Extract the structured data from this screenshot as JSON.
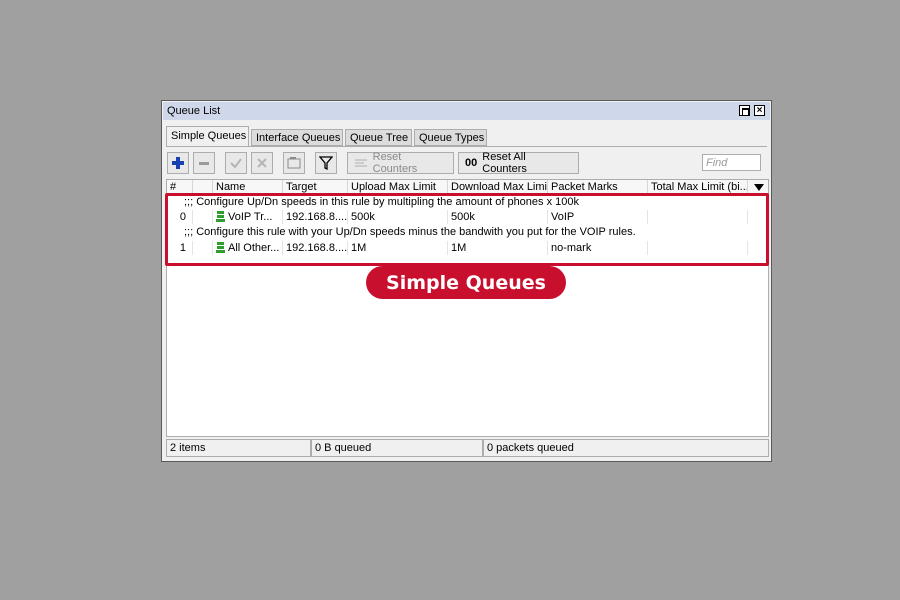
{
  "window": {
    "title": "Queue List"
  },
  "tabs": [
    {
      "label": "Simple Queues"
    },
    {
      "label": "Interface Queues"
    },
    {
      "label": "Queue Tree"
    },
    {
      "label": "Queue Types"
    }
  ],
  "toolbar": {
    "reset_counters": "Reset Counters",
    "reset_all_prefix": "00",
    "reset_all_counters": "Reset All Counters",
    "find_placeholder": "Find"
  },
  "columns": [
    "#",
    "",
    "Name",
    "Target",
    "Upload Max Limit",
    "Download Max Limit",
    "Packet Marks",
    "Total Max Limit (bi..."
  ],
  "rows": [
    {
      "comment": ";;; Configure Up/Dn speeds in this rule by multipling the amount of phones x 100k",
      "num": "0",
      "name": "VoIP Tr...",
      "target": "192.168.8....",
      "upload": "500k",
      "download": "500k",
      "marks": "VoIP",
      "total": ""
    },
    {
      "comment": ";;; Configure this rule with your Up/Dn speeds minus the bandwith you put for the VOIP rules.",
      "num": "1",
      "name": "All Other...",
      "target": "192.168.8....",
      "upload": "1M",
      "download": "1M",
      "marks": "no-mark",
      "total": ""
    }
  ],
  "status": {
    "items": "2 items",
    "queued_bytes": "0 B queued",
    "queued_packets": "0 packets queued"
  },
  "overlay": {
    "label": "Simple Queues"
  },
  "colors": {
    "accent": "#c8102e",
    "title_bar": "#cfd8ea",
    "queue_icon": "#2e9e2e"
  }
}
